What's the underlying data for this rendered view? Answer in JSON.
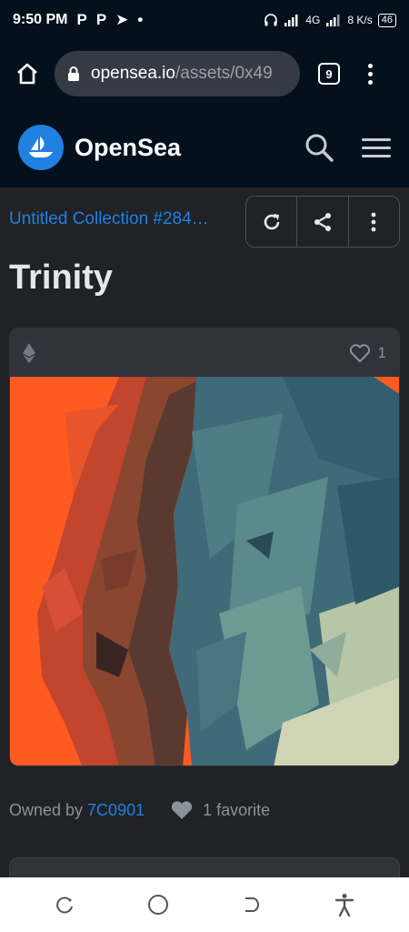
{
  "status_bar": {
    "time": "9:50 PM",
    "notification_glyphs": [
      "P",
      "P",
      "➤",
      "•"
    ],
    "network": "4G",
    "speed": "8 K/s",
    "battery": "46"
  },
  "browser": {
    "url_domain": "opensea.io",
    "url_path": "/assets/0x49",
    "tab_count": "9"
  },
  "header": {
    "brand": "OpenSea",
    "brand_color": "#2081e2"
  },
  "asset": {
    "collection": "Untitled Collection #284…",
    "title": "Trinity",
    "favorite_count": "1",
    "owned_by_label": "Owned by",
    "owner": "7C0901",
    "favorites_text": "1 favorite"
  },
  "icons": {
    "home": "home-icon",
    "lock": "lock-icon",
    "refresh": "refresh-icon",
    "share": "share-icon",
    "more": "more-vertical-icon",
    "eth": "ethereum-icon",
    "heart": "heart-icon"
  }
}
